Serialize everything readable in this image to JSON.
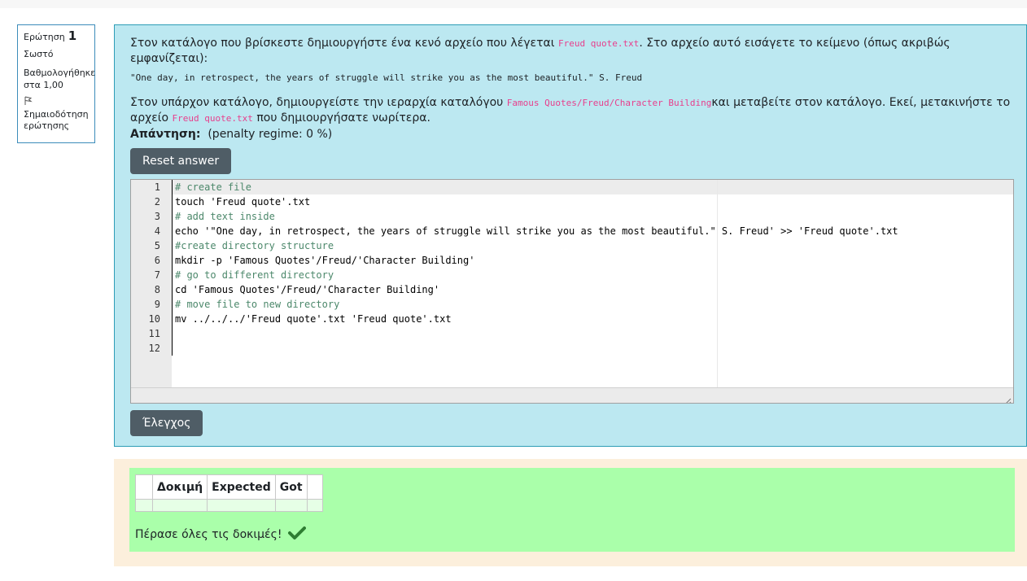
{
  "info": {
    "question_label": "Ερώτηση",
    "question_number": "1",
    "state": "Σωστό",
    "grade": "Βαθμολογήθηκε στα 1,00",
    "flag_label": "Σημαιοδότηση ερώτησης"
  },
  "question": {
    "p1_before": "Στον κατάλογο που βρίσκεστε δημιουργήστε ένα κενό αρχείο που λέγεται ",
    "p1_code": "Freud quote.txt",
    "p1_after": ". Στο αρχείο αυτό εισάγετε το κείμενο (όπως ακριβώς εμφανίζεται):",
    "quote": "\"One day, in retrospect, the years of struggle will strike you as the most beautiful.\" S. Freud",
    "p2_before": "Στον υπάρχον κατάλογο, δημιουργείστε την ιεραρχία καταλόγου ",
    "p2_code": "Famous Quotes/Freud/Character Building",
    "p2_mid": "και μεταβείτε στον κατάλογο. Εκεί, μετακινήστε το αρχείο ",
    "p2_code2": "Freud quote.txt",
    "p2_after": " που δημιουργήσατε νωρίτερα.",
    "answer_label": "Απάντηση:",
    "penalty": "(penalty regime: 0 %)"
  },
  "buttons": {
    "reset": "Reset answer",
    "check": "Έλεγχος"
  },
  "editor": {
    "line_numbers": [
      "1",
      "2",
      "3",
      "4",
      "5",
      "6",
      "7",
      "8",
      "9",
      "10",
      "11",
      "12"
    ],
    "lines": [
      "# create file",
      "touch 'Freud quote'.txt",
      "# add text inside",
      "echo '\"One day, in retrospect, the years of struggle will strike you as the most beautiful.\" S. Freud' >> 'Freud quote'.txt",
      "#create directory structure",
      "mkdir -p 'Famous Quotes'/Freud/'Character Building'",
      "# go to different directory",
      "cd 'Famous Quotes'/Freud/'Character Building'",
      "# move file to new directory",
      "mv ../../../'Freud quote'.txt 'Freud quote'.txt",
      "",
      ""
    ]
  },
  "results": {
    "headers": [
      "",
      "Δοκιμή",
      "Expected",
      "Got",
      ""
    ],
    "passed_text": "Πέρασε όλες τις δοκιμές!"
  },
  "colors": {
    "panel_bg": "#bce8f1",
    "button_bg": "#4f5d66",
    "feedback_bg": "#aaffaa",
    "outcome_bg": "#fcefdc",
    "check_mark": "#2e7d32"
  }
}
